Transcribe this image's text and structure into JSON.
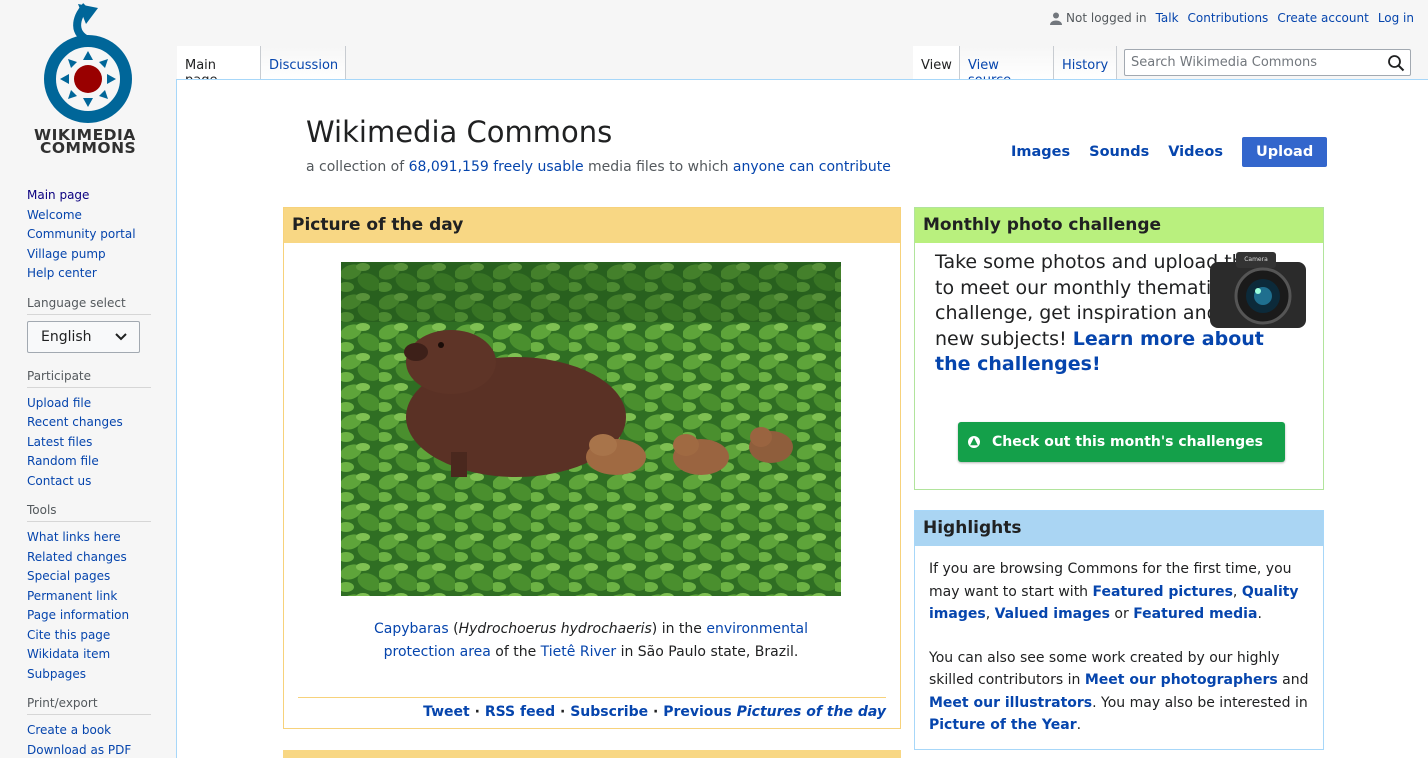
{
  "logo": {
    "line1": "WIKIMEDIA",
    "line2": "COMMONS"
  },
  "sidebar": {
    "nav": [
      "Main page",
      "Welcome",
      "Community portal",
      "Village pump",
      "Help center"
    ],
    "language": {
      "heading": "Language select",
      "selected": "English"
    },
    "participate": {
      "heading": "Participate",
      "items": [
        "Upload file",
        "Recent changes",
        "Latest files",
        "Random file",
        "Contact us"
      ]
    },
    "tools": {
      "heading": "Tools",
      "items": [
        "What links here",
        "Related changes",
        "Special pages",
        "Permanent link",
        "Page information",
        "Cite this page",
        "Wikidata item",
        "Subpages"
      ]
    },
    "print": {
      "heading": "Print/export",
      "items": [
        "Create a book",
        "Download as PDF"
      ]
    }
  },
  "personal": {
    "not_logged": "Not logged in",
    "talk": "Talk",
    "contributions": "Contributions",
    "create_account": "Create account",
    "login": "Log in"
  },
  "tabs": {
    "main": "Main page",
    "discussion": "Discussion",
    "view": "View",
    "view_source": "View source",
    "history": "History"
  },
  "search": {
    "placeholder": "Search Wikimedia Commons"
  },
  "header": {
    "title": "Wikimedia Commons",
    "sub_prefix": "a collection of ",
    "sub_count": "68,091,159",
    "sub_usable": "freely usable",
    "sub_middle": " media files to which ",
    "sub_anyone": "anyone can contribute",
    "links": {
      "images": "Images",
      "sounds": "Sounds",
      "videos": "Videos",
      "upload": "Upload"
    }
  },
  "potd": {
    "heading": "Picture of the day",
    "caption": {
      "capybaras": "Capybaras",
      "latin_open": " (",
      "latin": "Hydrochoerus hydrochaeris",
      "latin_close": ") in the ",
      "area": "environmental protection area",
      "of_the": " of the ",
      "river": "Tietê River",
      "rest": " in São Paulo state, Brazil."
    },
    "footer": {
      "tweet": "Tweet",
      "rss": "RSS feed",
      "subscribe": "Subscribe",
      "previous": "Previous ",
      "previous_em": "Pictures of the day",
      "sep": " · "
    }
  },
  "monthly": {
    "heading": "Monthly photo challenge",
    "text": "Take some photos and upload them to meet our monthly thematic challenge, get inspiration and try new subjects! ",
    "learn_more": "Learn more about the challenges!",
    "camera_label": "Camera",
    "button": "Check out this month's challenges"
  },
  "highlights": {
    "heading": "Highlights",
    "p1_a": "If you are browsing Commons for the first time, you may want to start with ",
    "featured_pictures": "Featured pictures",
    "comma1": ", ",
    "quality_images": "Quality images",
    "comma2": ", ",
    "valued_images": "Valued images",
    "or": " or ",
    "featured_media": "Featured media",
    "period": ".",
    "p2_a": "You can also see some work created by our highly skilled contributors in ",
    "meet_photographers": "Meet our photographers",
    "and": " and ",
    "meet_illustrators": "Meet our illustrators",
    "p2_b": ". You may also be interested in ",
    "picture_of_year": "Picture of the Year",
    "period2": "."
  },
  "colors": {
    "link": "#0645ad",
    "potd_head": "#f8d784",
    "monthly_head": "#b9f07e",
    "highlights_head": "#aad5f3",
    "upload_btn": "#3366cc",
    "challenge_btn": "#14a04a"
  },
  "icons": {
    "user": "user-icon",
    "search": "search-icon",
    "chevron": "chevron-down-icon",
    "camera": "camera-icon",
    "arrow": "arrow-up-circle-icon"
  }
}
